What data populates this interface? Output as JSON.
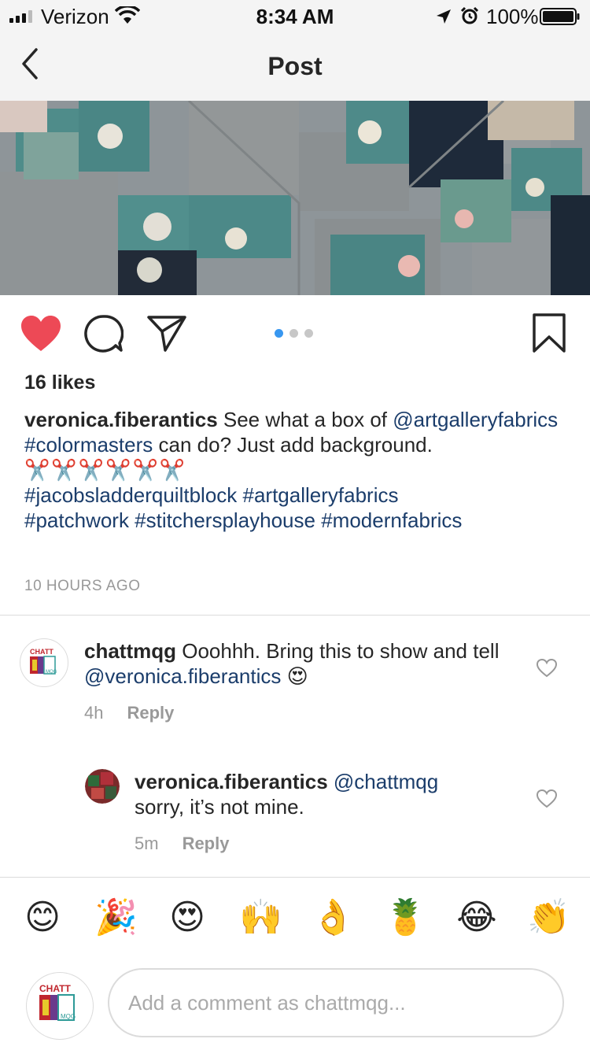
{
  "status_bar": {
    "carrier": "Verizon",
    "time": "8:34 AM",
    "battery": "100%"
  },
  "nav": {
    "title": "Post"
  },
  "post": {
    "likes": "16 likes",
    "caption": {
      "username": "veronica.fiberantics",
      "text1": " See what a box of ",
      "mention": "@artgalleryfabrics",
      "hashtag1": "#colormasters",
      "text2": " can do? Just add background.",
      "scissors": "✂️✂️✂️✂️✂️✂️",
      "hashtags_line1": "#jacobsladderquiltblock #artgalleryfabrics",
      "hashtags_line2": "#patchwork #stitchersplayhouse #modernfabrics"
    },
    "time_ago": "10 HOURS AGO",
    "carousel": {
      "count": 3,
      "active": 1
    }
  },
  "comments": [
    {
      "username": "chattmqg",
      "text": " Ooohhh. Bring this to show and tell ",
      "mention": "@veronica.fiberantics",
      "emoji": "😍",
      "time": "4h",
      "reply_label": "Reply"
    },
    {
      "username": "veronica.fiberantics",
      "mention": "@chattmqg",
      "text": "sorry, it’s not mine.",
      "time": "5m",
      "reply_label": "Reply"
    }
  ],
  "avatar_logo": {
    "top": "CHATT",
    "side": "MQG"
  },
  "emoji_bar": [
    "😊",
    "🎉",
    "😍",
    "🙌",
    "👌",
    "🍍",
    "😂",
    "👏"
  ],
  "comment_input": {
    "placeholder": "Add a comment as chattmqg..."
  },
  "colors": {
    "like_red": "#ed4956",
    "link_blue": "#1b3d6b",
    "dot_active": "#3897f0",
    "nav_bg": "#f4f4f4"
  }
}
